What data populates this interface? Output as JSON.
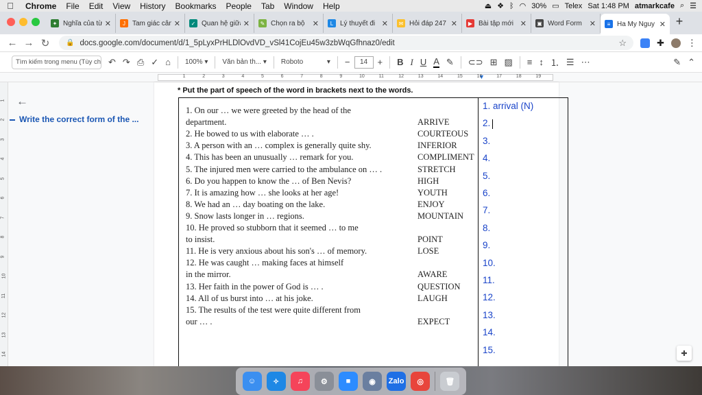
{
  "menubar": {
    "apple": "",
    "items": [
      "Chrome",
      "File",
      "Edit",
      "View",
      "History",
      "Bookmarks",
      "People",
      "Tab",
      "Window",
      "Help"
    ],
    "battery": "30%",
    "input_method": "Telex",
    "clock": "Sat 1:48 PM",
    "user": "atmarkcafe"
  },
  "tabs": [
    {
      "title": "Nghĩa của từ",
      "fav_color": "#2e7d32",
      "fav_glyph": "✦"
    },
    {
      "title": "Tam giác cân",
      "fav_color": "#ff6f00",
      "fav_glyph": "J"
    },
    {
      "title": "Quan hệ giữa",
      "fav_color": "#00897b",
      "fav_glyph": "✓"
    },
    {
      "title": "Chọn ra bộ",
      "fav_color": "#7cb342",
      "fav_glyph": "✎"
    },
    {
      "title": "Lý thuyết đi",
      "fav_color": "#1e88e5",
      "fav_glyph": "L"
    },
    {
      "title": "Hỏi đáp 247",
      "fav_color": "#fbc02d",
      "fav_glyph": "✉"
    },
    {
      "title": "Bài tập mới",
      "fav_color": "#e53935",
      "fav_glyph": "▶"
    },
    {
      "title": "Word Form",
      "fav_color": "#444",
      "fav_glyph": "▣"
    },
    {
      "title": "Ha My Nguy",
      "fav_color": "#1a73e8",
      "fav_glyph": "≡",
      "active": true
    }
  ],
  "address": {
    "url": "docs.google.com/document/d/1_5pLyxPrHLDlOvdVD_vSl41CojEu45w3zbWqGfhnaz0/edit"
  },
  "toolbar": {
    "search_placeholder": "Tìm kiếm trong menu (Tùy chọ",
    "zoom": "100%",
    "style": "Văn bản th...",
    "font": "Roboto",
    "font_size": "14"
  },
  "outline": {
    "item": "Write the correct form of the ..."
  },
  "document": {
    "instruction": "* Put the part of speech of the word in brackets next to the words.",
    "exercise": [
      {
        "text": "1. On our … we were greeted by the head of the",
        "word": ""
      },
      {
        "text": "    department.",
        "word": "ARRIVE"
      },
      {
        "text": "2. He bowed to us with elaborate … .",
        "word": "COURTEOUS"
      },
      {
        "text": "3. A person with an … complex is generally quite shy.",
        "word": "INFERIOR"
      },
      {
        "text": "4. This has been an unusually … remark for you.",
        "word": "COMPLIMENT"
      },
      {
        "text": "5. The injured men were carried to the ambulance on … .",
        "word": "STRETCH"
      },
      {
        "text": "6. Do you happen to know the … of Ben Nevis?",
        "word": "HIGH"
      },
      {
        "text": "7. It is amazing how … she looks at her age!",
        "word": "YOUTH"
      },
      {
        "text": "8. We had an … day boating on the lake.",
        "word": "ENJOY"
      },
      {
        "text": "9. Snow lasts longer in … regions.",
        "word": "MOUNTAIN"
      },
      {
        "text": "10. He proved so stubborn that it seemed … to me",
        "word": ""
      },
      {
        "text": "     to insist.",
        "word": "POINT"
      },
      {
        "text": "11. He is very anxious about his son's … of memory.",
        "word": "LOSE"
      },
      {
        "text": "12. He was caught … making faces at himself",
        "word": ""
      },
      {
        "text": "     in the mirror.",
        "word": "AWARE"
      },
      {
        "text": "13. Her faith in the power of God is … .",
        "word": "QUESTION"
      },
      {
        "text": "14. All of us burst into … at his joke.",
        "word": "LAUGH"
      },
      {
        "text": "15. The results of the test were quite different from",
        "word": ""
      },
      {
        "text": "     our … .",
        "word": "EXPECT"
      }
    ],
    "answers": [
      "1. arrival (N)",
      "2.",
      "3.",
      "4.",
      "5.",
      "6.",
      "7.",
      "8.",
      "9.",
      "10.",
      "11.",
      "12.",
      "13.",
      "14.",
      "15."
    ]
  },
  "dock": [
    {
      "name": "finder",
      "color": "#3b8ff0",
      "glyph": "☺"
    },
    {
      "name": "safari",
      "color": "#1e88e5",
      "glyph": "✧"
    },
    {
      "name": "music",
      "color": "#f5445a",
      "glyph": "♫"
    },
    {
      "name": "system-preferences",
      "color": "#8a8f98",
      "glyph": "⚙"
    },
    {
      "name": "zoom",
      "color": "#2d8cff",
      "glyph": "■"
    },
    {
      "name": "messenger",
      "color": "#6a7fa0",
      "glyph": "◉"
    },
    {
      "name": "zalo",
      "color": "#1f6fe5",
      "glyph": "Zalo"
    },
    {
      "name": "chrome",
      "color": "#e8453c",
      "glyph": "◎"
    },
    {
      "name": "trash",
      "color": "#c9ccd1",
      "glyph": "🗑"
    }
  ]
}
